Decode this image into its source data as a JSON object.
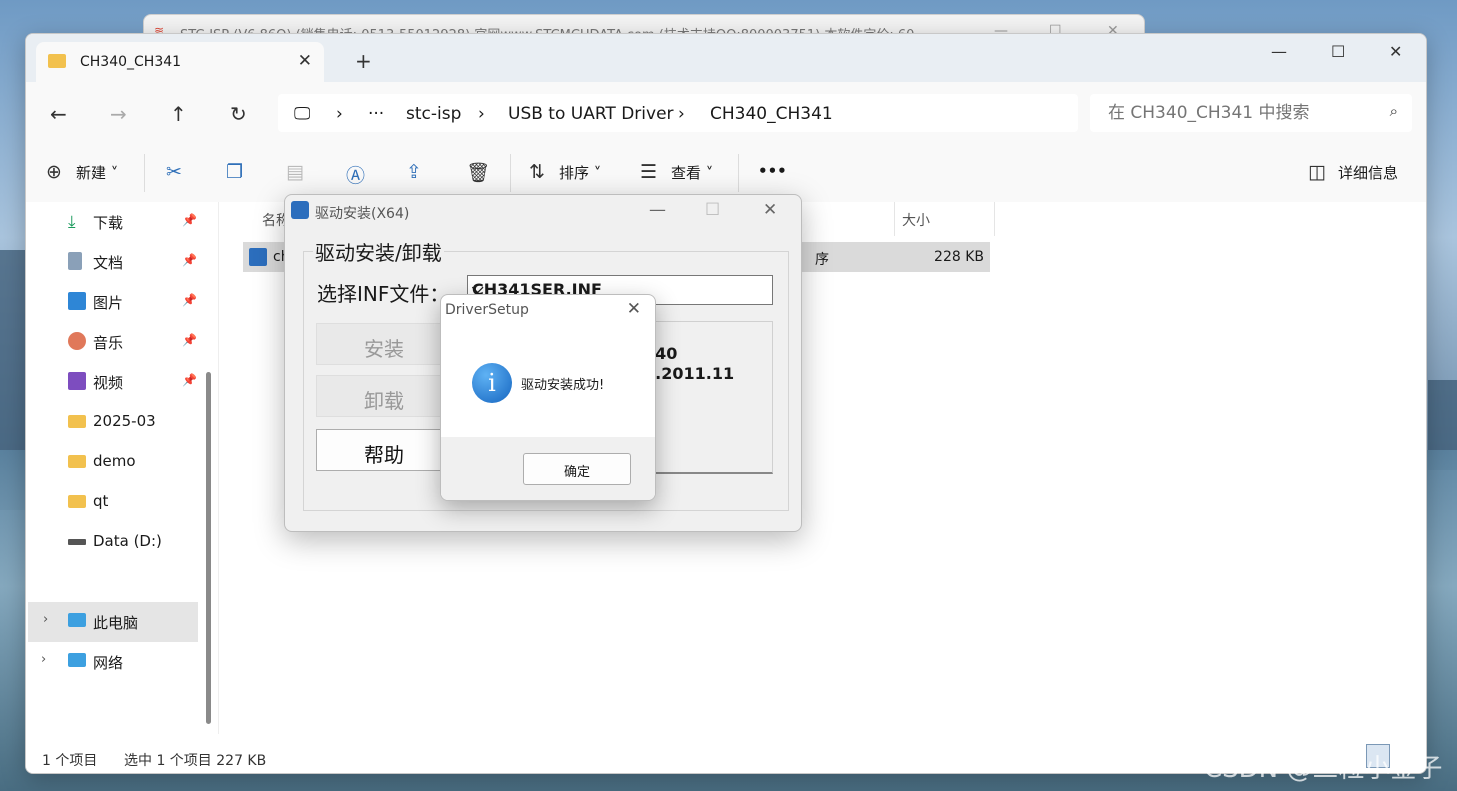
{
  "background_window": {
    "title": "STC-ISP (V6.86Q) (销售电话: 0513-55012928) 官网www.STCMCUDATA.com  (技术支持QQ:800003751) 本软件定价: 60"
  },
  "explorer": {
    "tab_label": "CH340_CH341",
    "breadcrumb": [
      "stc-isp",
      "USB to UART Driver",
      "CH340_CH341"
    ],
    "search_placeholder": "在 CH340_CH341 中搜索",
    "toolbar": {
      "new_label": "新建",
      "sort_label": "排序",
      "view_label": "查看",
      "more_label": "•••",
      "details_label": "详细信息"
    },
    "sidebar": {
      "quick": [
        {
          "label": "下载",
          "icon": "download-icon"
        },
        {
          "label": "文档",
          "icon": "document-icon"
        },
        {
          "label": "图片",
          "icon": "picture-icon"
        },
        {
          "label": "音乐",
          "icon": "music-icon"
        },
        {
          "label": "视频",
          "icon": "video-icon"
        }
      ],
      "folders": [
        "2025-03",
        "demo",
        "qt"
      ],
      "drive": "Data (D:)",
      "this_pc": "此电脑",
      "network": "网络"
    },
    "columns": {
      "name": "名称",
      "size": "大小"
    },
    "file_row": {
      "name_partial": "ch",
      "type_partial": "序",
      "size": "228 KB"
    },
    "status": {
      "count": "1 个项目",
      "selection": "选中 1 个项目  227 KB"
    }
  },
  "driver_dialog": {
    "title": "驱动安装(X64)",
    "group_label": "驱动安装/卸载",
    "inf_label": "选择INF文件：",
    "inf_value": "CH341SER.INF",
    "install_label": "安装",
    "uninstall_label": "卸载",
    "help_label": "帮助",
    "info_line1": "340",
    "info_line2": "3.2011.11"
  },
  "message_box": {
    "title": "DriverSetup",
    "message": "驱动安装成功!",
    "ok_label": "确定",
    "icon_glyph": "i"
  },
  "watermark": "CSDN @三粒小金子"
}
